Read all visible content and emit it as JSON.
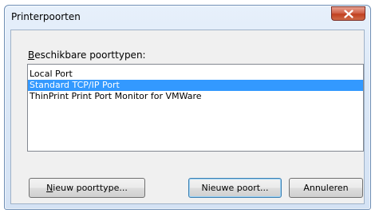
{
  "window": {
    "title": "Printerpoorten"
  },
  "group": {
    "label_accel": "B",
    "label_rest": "eschikbare poorttypen:"
  },
  "ports": [
    {
      "label": "Local Port",
      "selected": false
    },
    {
      "label": "Standard TCP/IP Port",
      "selected": true
    },
    {
      "label": "ThinPrint Print Port Monitor for VMWare",
      "selected": false
    }
  ],
  "buttons": {
    "new_port_type_accel": "N",
    "new_port_type_rest": "ieuw poorttype...",
    "new_port": "Nieuwe poort...",
    "cancel": "Annuleren"
  },
  "colors": {
    "selection": "#3399ff",
    "close_button": "#c8492a"
  }
}
